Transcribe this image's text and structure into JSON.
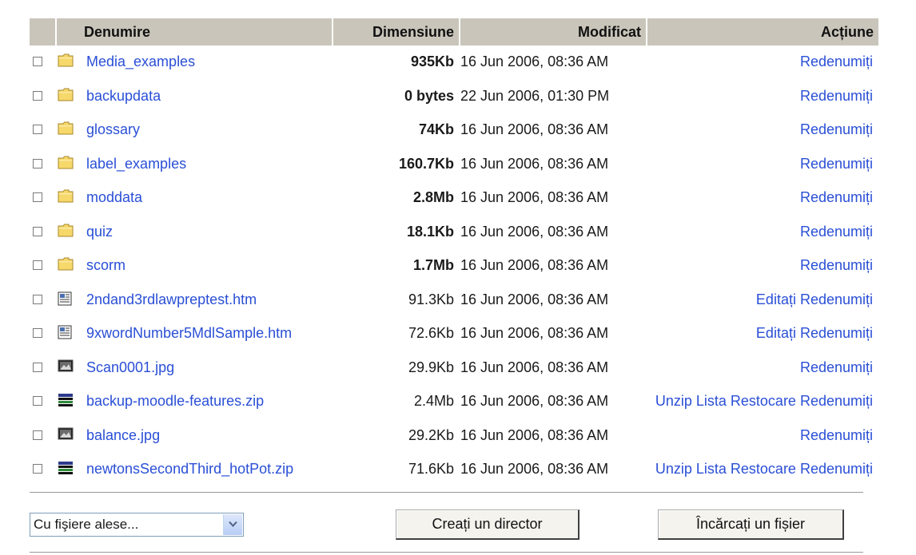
{
  "header": {
    "name": "Denumire",
    "size": "Dimensiune",
    "modified": "Modificat",
    "action": "Acțiune"
  },
  "files": [
    {
      "name": "Media_examples",
      "icon": "folder-icon",
      "size": "935Kb",
      "size_bold": true,
      "modified": "16 Jun 2006, 08:36 AM",
      "actions": [
        "Redenumiți"
      ]
    },
    {
      "name": "backupdata",
      "icon": "folder-icon",
      "size": "0 bytes",
      "size_bold": true,
      "modified": "22 Jun 2006, 01:30 PM",
      "actions": [
        "Redenumiți"
      ]
    },
    {
      "name": "glossary",
      "icon": "folder-icon",
      "size": "74Kb",
      "size_bold": true,
      "modified": "16 Jun 2006, 08:36 AM",
      "actions": [
        "Redenumiți"
      ]
    },
    {
      "name": "label_examples",
      "icon": "folder-icon",
      "size": "160.7Kb",
      "size_bold": true,
      "modified": "16 Jun 2006, 08:36 AM",
      "actions": [
        "Redenumiți"
      ]
    },
    {
      "name": "moddata",
      "icon": "folder-icon",
      "size": "2.8Mb",
      "size_bold": true,
      "modified": "16 Jun 2006, 08:36 AM",
      "actions": [
        "Redenumiți"
      ]
    },
    {
      "name": "quiz",
      "icon": "folder-icon",
      "size": "18.1Kb",
      "size_bold": true,
      "modified": "16 Jun 2006, 08:36 AM",
      "actions": [
        "Redenumiți"
      ]
    },
    {
      "name": "scorm",
      "icon": "folder-icon",
      "size": "1.7Mb",
      "size_bold": true,
      "modified": "16 Jun 2006, 08:36 AM",
      "actions": [
        "Redenumiți"
      ]
    },
    {
      "name": "2ndand3rdlawpreptest.htm",
      "icon": "html-file-icon",
      "size": "91.3Kb",
      "size_bold": false,
      "modified": "16 Jun 2006, 08:36 AM",
      "actions": [
        "Editați",
        "Redenumiți"
      ]
    },
    {
      "name": "9xwordNumber5MdlSample.htm",
      "icon": "html-file-icon",
      "size": "72.6Kb",
      "size_bold": false,
      "modified": "16 Jun 2006, 08:36 AM",
      "actions": [
        "Editați",
        "Redenumiți"
      ]
    },
    {
      "name": "Scan0001.jpg",
      "icon": "image-file-icon",
      "size": "29.9Kb",
      "size_bold": false,
      "modified": "16 Jun 2006, 08:36 AM",
      "actions": [
        "Redenumiți"
      ]
    },
    {
      "name": "backup-moodle-features.zip",
      "icon": "zip-file-icon",
      "size": "2.4Mb",
      "size_bold": false,
      "modified": "16 Jun 2006, 08:36 AM",
      "actions": [
        "Unzip",
        "Lista",
        "Restocare",
        "Redenumiți"
      ]
    },
    {
      "name": "balance.jpg",
      "icon": "image-file-icon",
      "size": "29.2Kb",
      "size_bold": false,
      "modified": "16 Jun 2006, 08:36 AM",
      "actions": [
        "Redenumiți"
      ]
    },
    {
      "name": "newtonsSecondThird_hotPot.zip",
      "icon": "zip-file-icon",
      "size": "71.6Kb",
      "size_bold": false,
      "modified": "16 Jun 2006, 08:36 AM",
      "actions": [
        "Unzip",
        "Lista",
        "Restocare",
        "Redenumiți"
      ]
    }
  ],
  "controls": {
    "with_selected": "Cu fişiere alese...",
    "make_dir_button": "Creați un director",
    "upload_button": "Încărcați un fișier"
  },
  "colors": {
    "link": "#2a4fd6",
    "header_bg": "#c9c5ba",
    "folder_fill": "#f6d86b"
  }
}
